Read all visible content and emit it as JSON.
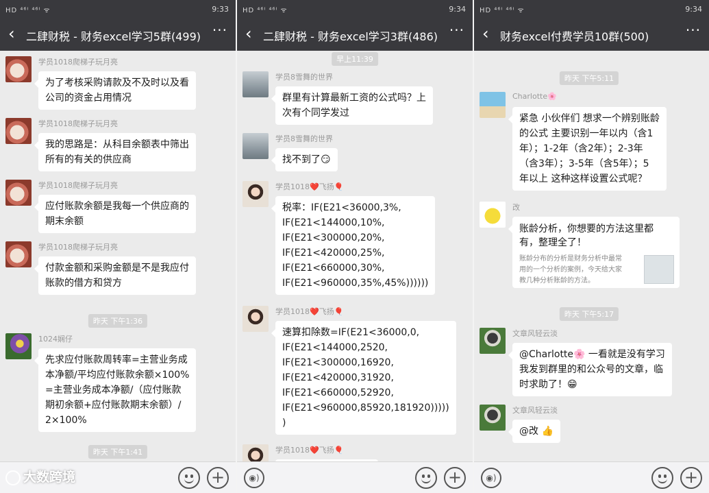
{
  "panels": [
    {
      "status": {
        "left": "HD ⁴⁶ᴵ ⁴⁶ᴵ ᯤ",
        "time": "9:33"
      },
      "title": "二肆财税 - 财务excel学习5群(499)",
      "messages": [
        {
          "sender": "学员1018爬梯子玩月亮",
          "lines": [
            "为了考核采购请款及不及时以及看",
            "公司的资金占用情况"
          ]
        },
        {
          "sender": "学员1018爬梯子玩月亮",
          "lines": [
            "我的思路是：从科目余额表中筛出",
            "所有的有关的供应商"
          ]
        },
        {
          "sender": "学员1018爬梯子玩月亮",
          "lines": [
            "应付账款余额是我每一个供应商的",
            "期末余额"
          ]
        },
        {
          "sender": "学员1018爬梯子玩月亮",
          "lines": [
            "付款金额和采购金额是不是我应付",
            "账款的借方和贷方"
          ]
        },
        {
          "sender": "1024娴仔",
          "lines": [
            "先求应付账款周转率=主营业务成",
            "本净额/平均应付账款余额×100%",
            "=主营业务成本净额/（应付账款",
            "期初余额+应付账款期末余额）/",
            "2×100%"
          ]
        }
      ],
      "timestamps": [
        "昨天 下午1:36",
        "昨天 下午1:41"
      ]
    },
    {
      "status": {
        "left": "HD ⁴⁶ᴵ ⁴⁶ᴵ ᯤ",
        "time": "9:34"
      },
      "title": "二肆财税 - 财务excel学习3群(486)",
      "timestamps": [
        "早上11:39"
      ],
      "messages": [
        {
          "sender": "学员8雪舞的世界",
          "lines": [
            "群里有计算最新工资的公式吗？上",
            "次有个同学发过"
          ]
        },
        {
          "sender": "学员8雪舞的世界",
          "lines": [
            "找不到了😏"
          ]
        },
        {
          "sender": "学员1018❤️飞扬🎈",
          "lines": [
            "税率：IF(E21<36000,3%,",
            "IF(E21<144000,10%,",
            "IF(E21<300000,20%,",
            "IF(E21<420000,25%,",
            "IF(E21<660000,30%,",
            "IF(E21<960000,35%,45%))))))"
          ]
        },
        {
          "sender": "学员1018❤️飞扬🎈",
          "lines": [
            "速算扣除数=IF(E21<36000,0,",
            "IF(E21<144000,2520,",
            "IF(E21<300000,16920,",
            "IF(E21<420000,31920,",
            "IF(E21<660000,52920,",
            "IF(E21<960000,85920,181920)))))",
            ")"
          ]
        },
        {
          "sender": "学员1018❤️飞扬🎈",
          "lines": []
        }
      ]
    },
    {
      "status": {
        "left": "HD ⁴⁶ᴵ ⁴⁶ᴵ ᯤ",
        "time": "9:34"
      },
      "title": "财务excel付费学员10群(500)",
      "timestamps": [
        "昨天 下午5:11",
        "昨天 下午5:17"
      ],
      "messages": [
        {
          "sender": "Charlotte🌸",
          "lines": [
            "紧急 小伙伴们 想求一个辨别账龄",
            "的公式 主要识别一年以内（含1",
            "年）；1-2年（含2年）；2-3年",
            "（含3年）；3-5年（含5年）；5",
            "年以上  这种这样设置公式呢？"
          ]
        },
        {
          "sender": "改",
          "card": {
            "title_lines": [
              "账龄分析，你想要的方法这里都",
              "有，整理全了！"
            ],
            "desc_lines": [
              "账龄分布的分析是财务分析中最常",
              "用的一个分析的案例，今天给大家",
              "教几种分析账龄的方法。"
            ]
          }
        },
        {
          "sender": "文章风轻云淡",
          "lines": [
            "@Charlotte🌸 一看就是没有学习",
            "我发到群里的和公众号的文章，临",
            "时求助了！😁"
          ]
        },
        {
          "sender": "文章风轻云淡",
          "lines": [
            "@改 👍"
          ]
        }
      ]
    }
  ],
  "watermark": "大数跨境",
  "icons": {
    "back": "‹",
    "more": "···",
    "voice": "◉)",
    "plus": "+"
  }
}
